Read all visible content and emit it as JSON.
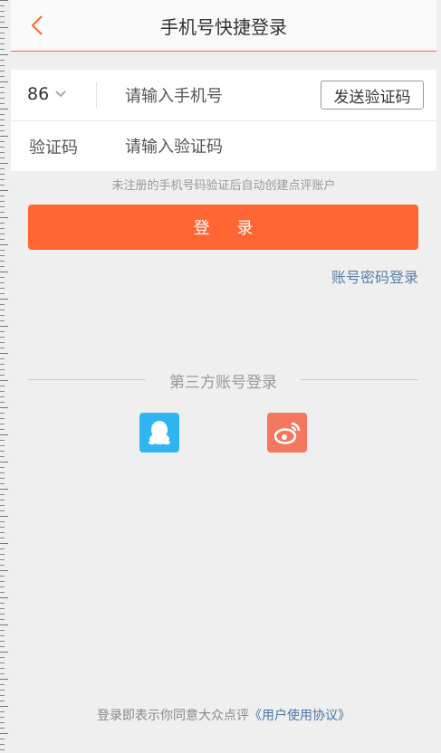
{
  "header": {
    "title": "手机号快捷登录",
    "back_icon": "chevron-left-icon",
    "accent_color": "#ff6633"
  },
  "form": {
    "country_code": "86",
    "country_chevron_icon": "chevron-down-icon",
    "phone_placeholder": "请输入手机号",
    "send_code_label": "发送验证码",
    "code_label": "验证码",
    "code_placeholder": "请输入验证码"
  },
  "hint": "未注册的手机号码验证后自动创建点评账户",
  "login_button": "登 录",
  "password_login_link": "账号密码登录",
  "third_party": {
    "label": "第三方账号登录",
    "providers": [
      {
        "name": "qq-icon",
        "color": "#2fb5f0"
      },
      {
        "name": "weibo-icon",
        "color": "#f47760"
      }
    ]
  },
  "footer": {
    "prefix": "登录即表示你同意大众点评",
    "agreement": "《用户使用协议》"
  }
}
